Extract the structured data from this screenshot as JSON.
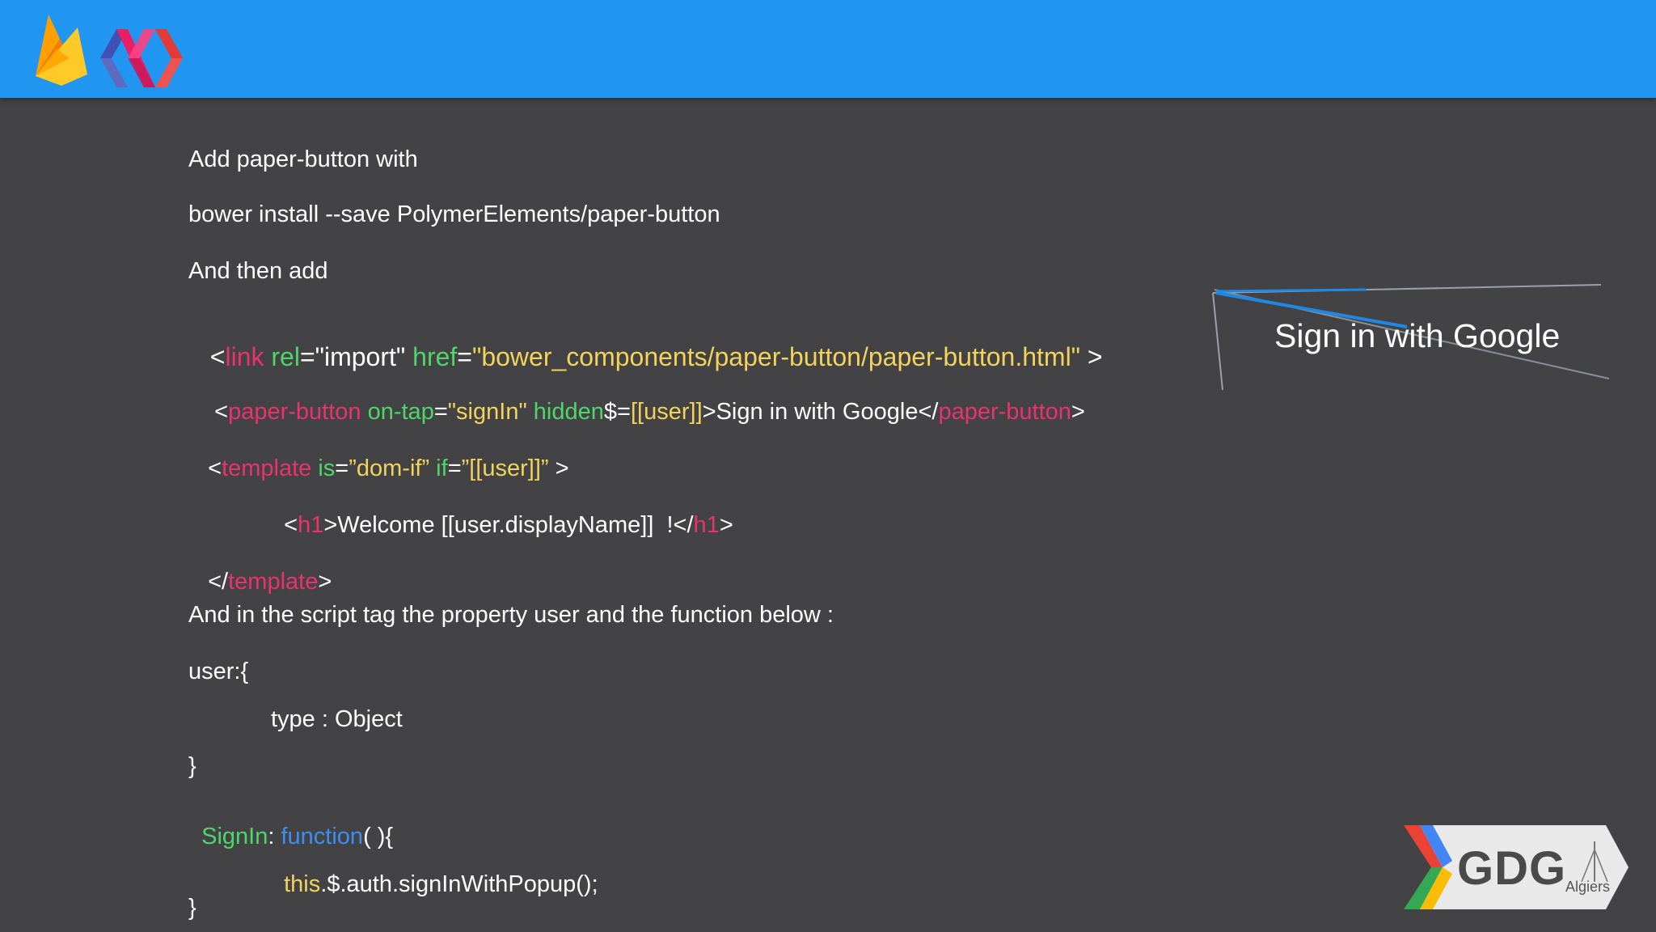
{
  "slide": {
    "intro": "Add paper-button with",
    "install_cmd": "bower install --save PolymerElements/paper-button",
    "then_add": "And then add",
    "code_link": {
      "open": "<",
      "tag": "link",
      "attr1": " rel",
      "eq1": "=",
      "val1": "\"import\"",
      "attr2": " href",
      "eq2": "=",
      "val2": "\"bower_components/paper-button/paper-button.html\"",
      "close": " >"
    },
    "code_button": {
      "open": "<",
      "tag": "paper-button",
      "attr1": " on-tap",
      "eq1": "=",
      "val1": "\"signIn\"",
      "attr2": " hidden",
      "eq2": "$=",
      "val2": "[[user]]",
      "content": ">Sign in with Google</",
      "tag_close": "paper-button",
      "close": ">"
    },
    "code_template": {
      "open": "<",
      "tag": "template",
      "attr1": " is",
      "eq1": "=",
      "val1": "”dom-if”",
      "attr2": " if",
      "eq2": "=",
      "val2": "”[[user]]”",
      "close": " >"
    },
    "code_h1": {
      "open": "<",
      "tag": "h1",
      "content": ">Welcome [[user.displayName]]  !</",
      "tag_close": "h1",
      "close": ">"
    },
    "code_template_close": {
      "open": "</",
      "tag": "template",
      "close": ">"
    },
    "script_note": "And in the script tag the property user and the function below :",
    "user_open": "user:{",
    "type_line": "type : Object",
    "brace_close_1": "}",
    "signin_name": "SignIn",
    "signin_colon": ": ",
    "signin_kw": "function",
    "signin_rest": "( ){",
    "popup_this": "this",
    "popup_rest": ".$.auth.signInWithPopup();",
    "brace_close_2": "}"
  },
  "demo_button": {
    "label": "Sign in with Google"
  },
  "branding": {
    "left_logos": [
      "firebase-logo",
      "polymer-logo"
    ],
    "gdg_text": "GDG",
    "gdg_sub": "Algiers"
  },
  "colors": {
    "header": "#2196f0",
    "background": "#434245",
    "tag": "#e8346a",
    "attribute": "#4fd66a",
    "string": "#f2d35b",
    "keyword": "#3b8ff0"
  }
}
